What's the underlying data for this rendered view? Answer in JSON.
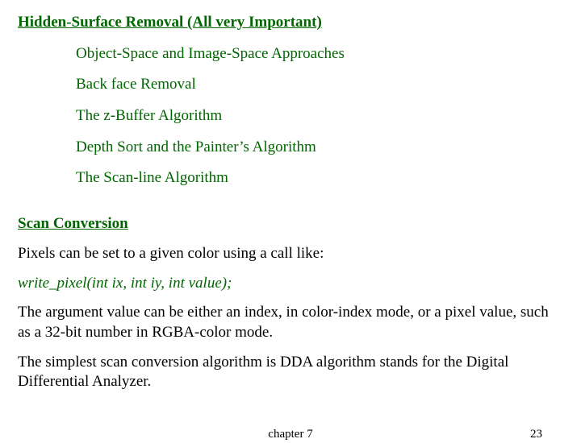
{
  "section1": {
    "title": "Hidden-Surface Removal (All very Important)",
    "items": [
      "Object-Space and Image-Space Approaches",
      "Back face Removal",
      "The z-Buffer Algorithm",
      "Depth Sort and the Painter’s Algorithm",
      "The Scan-line Algorithm"
    ]
  },
  "section2": {
    "title": "Scan Conversion",
    "p1": "Pixels can be set to a given color using a call like:",
    "code": "write_pixel(int ix, int iy, int value);",
    "p2": "The argument value can be either an index, in color-index mode, or a pixel value, such as a 32-bit number in RGBA-color mode.",
    "p3": "The simplest scan conversion algorithm is DDA algorithm stands for the Digital Differential Analyzer."
  },
  "footer": {
    "chapter": "chapter 7",
    "page": "23"
  }
}
